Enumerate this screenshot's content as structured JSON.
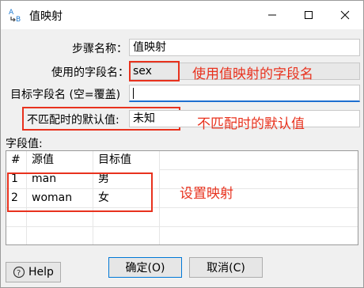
{
  "window": {
    "title": "值映射"
  },
  "form": {
    "step_name_label": "步骤名称：",
    "step_name_value": "值映射",
    "field_label": "使用的字段名：",
    "field_value": "sex",
    "target_label": "目标字段名 (空=覆盖)",
    "target_value": "",
    "default_label": "不匹配时的默认值:",
    "default_value": "未知",
    "fields_label": "字段值:"
  },
  "annotations": {
    "field_note": "使用值映射的字段名",
    "default_note": "不匹配时的默认值",
    "mapping_note": "设置映射"
  },
  "table": {
    "headers": [
      "#",
      "源值",
      "目标值"
    ],
    "rows": [
      [
        "1",
        "man",
        "男"
      ],
      [
        "2",
        "woman",
        "女"
      ]
    ]
  },
  "buttons": {
    "help": "Help",
    "ok": "确定(O)",
    "cancel": "取消(C)"
  },
  "colors": {
    "annotation": "#e8321e"
  }
}
